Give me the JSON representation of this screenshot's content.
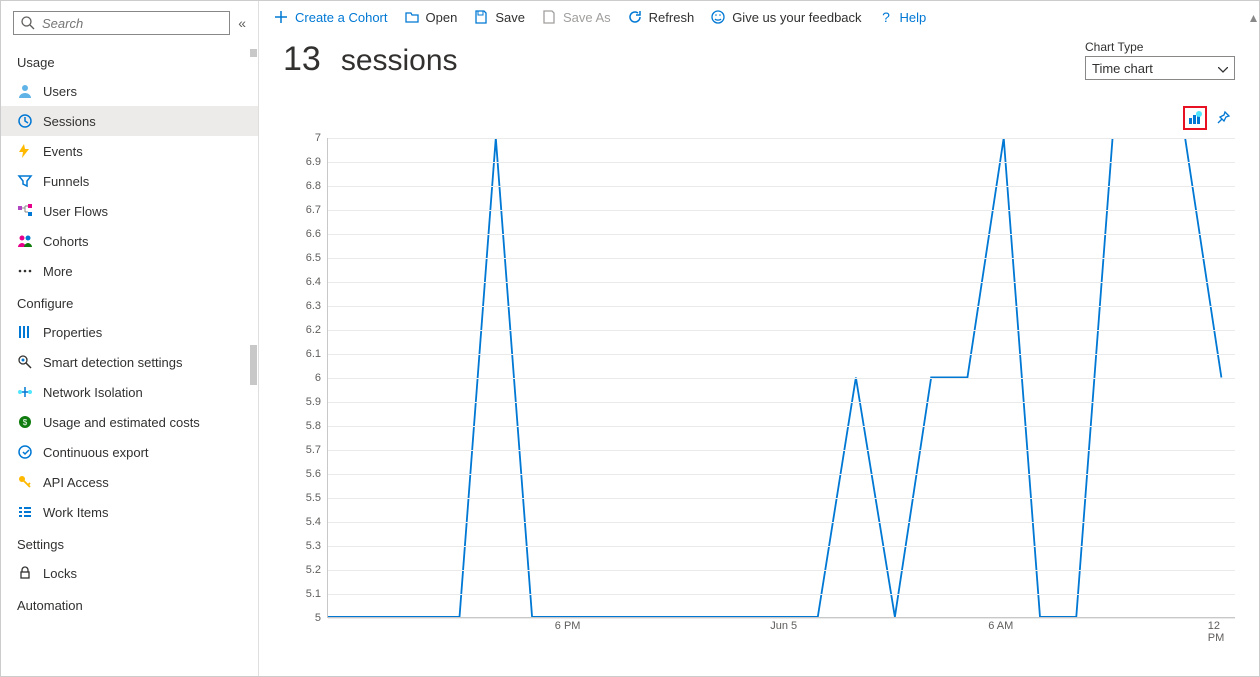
{
  "search": {
    "placeholder": "Search"
  },
  "sidebar": {
    "sections": {
      "usage": {
        "label": "Usage",
        "items": [
          {
            "label": "Users"
          },
          {
            "label": "Sessions"
          },
          {
            "label": "Events"
          },
          {
            "label": "Funnels"
          },
          {
            "label": "User Flows"
          },
          {
            "label": "Cohorts"
          },
          {
            "label": "More"
          }
        ]
      },
      "configure": {
        "label": "Configure",
        "items": [
          {
            "label": "Properties"
          },
          {
            "label": "Smart detection settings"
          },
          {
            "label": "Network Isolation"
          },
          {
            "label": "Usage and estimated costs"
          },
          {
            "label": "Continuous export"
          },
          {
            "label": "API Access"
          },
          {
            "label": "Work Items"
          }
        ]
      },
      "settings": {
        "label": "Settings",
        "items": [
          {
            "label": "Locks"
          }
        ]
      },
      "automation": {
        "label": "Automation"
      }
    }
  },
  "toolbar": {
    "create": "Create a Cohort",
    "open": "Open",
    "save": "Save",
    "saveas": "Save As",
    "refresh": "Refresh",
    "feedback": "Give us your feedback",
    "help": "Help"
  },
  "header": {
    "count": "13",
    "word": "sessions"
  },
  "chartType": {
    "label": "Chart Type",
    "value": "Time chart"
  },
  "chart_data": {
    "type": "line",
    "title": "sessions",
    "xlabel": "",
    "ylabel": "",
    "ylim": [
      5,
      7
    ],
    "y_ticks": [
      "7",
      "6.9",
      "6.8",
      "6.7",
      "6.6",
      "6.5",
      "6.4",
      "6.3",
      "6.2",
      "6.1",
      "6",
      "5.9",
      "5.8",
      "5.7",
      "5.6",
      "5.5",
      "5.4",
      "5.3",
      "5.2",
      "5.1",
      "5"
    ],
    "x_ticks": [
      {
        "pos": 0.265,
        "label": "6 PM"
      },
      {
        "pos": 0.503,
        "label": "Jun 5"
      },
      {
        "pos": 0.742,
        "label": "6 AM"
      },
      {
        "pos": 0.98,
        "label": "12 PM"
      }
    ],
    "series": [
      {
        "name": "sessions",
        "color": "#0078d4",
        "points": [
          {
            "x": 0.0,
            "y": 5.0
          },
          {
            "x": 0.145,
            "y": 5.0
          },
          {
            "x": 0.185,
            "y": 7.0
          },
          {
            "x": 0.225,
            "y": 5.0
          },
          {
            "x": 0.54,
            "y": 5.0
          },
          {
            "x": 0.582,
            "y": 6.0
          },
          {
            "x": 0.625,
            "y": 5.0
          },
          {
            "x": 0.665,
            "y": 6.0
          },
          {
            "x": 0.705,
            "y": 6.0
          },
          {
            "x": 0.745,
            "y": 7.0
          },
          {
            "x": 0.785,
            "y": 5.0
          },
          {
            "x": 0.825,
            "y": 5.0
          },
          {
            "x": 0.865,
            "y": 7.0
          },
          {
            "x": 0.945,
            "y": 7.0
          },
          {
            "x": 0.985,
            "y": 6.0
          }
        ]
      }
    ]
  }
}
